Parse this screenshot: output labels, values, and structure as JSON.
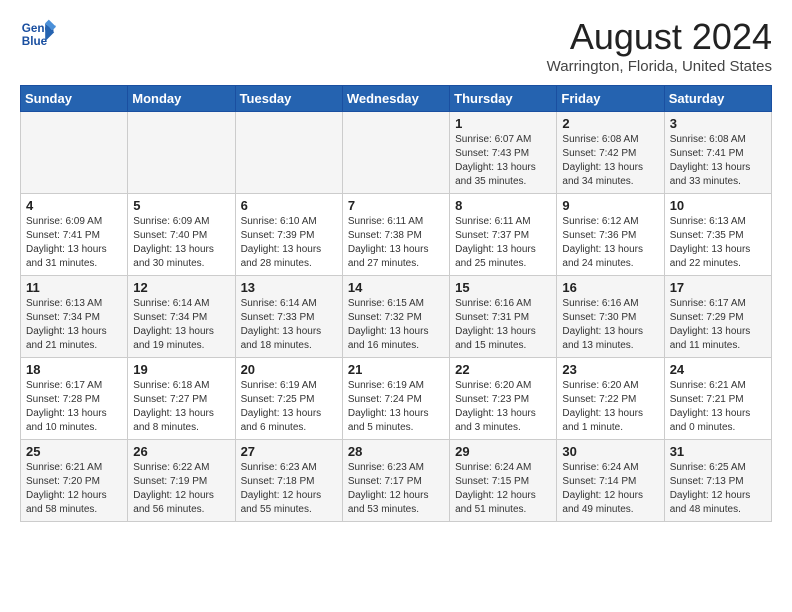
{
  "header": {
    "logo_line1": "General",
    "logo_line2": "Blue",
    "title": "August 2024",
    "subtitle": "Warrington, Florida, United States"
  },
  "weekdays": [
    "Sunday",
    "Monday",
    "Tuesday",
    "Wednesday",
    "Thursday",
    "Friday",
    "Saturday"
  ],
  "weeks": [
    [
      {
        "day": "",
        "info": ""
      },
      {
        "day": "",
        "info": ""
      },
      {
        "day": "",
        "info": ""
      },
      {
        "day": "",
        "info": ""
      },
      {
        "day": "1",
        "info": "Sunrise: 6:07 AM\nSunset: 7:43 PM\nDaylight: 13 hours\nand 35 minutes."
      },
      {
        "day": "2",
        "info": "Sunrise: 6:08 AM\nSunset: 7:42 PM\nDaylight: 13 hours\nand 34 minutes."
      },
      {
        "day": "3",
        "info": "Sunrise: 6:08 AM\nSunset: 7:41 PM\nDaylight: 13 hours\nand 33 minutes."
      }
    ],
    [
      {
        "day": "4",
        "info": "Sunrise: 6:09 AM\nSunset: 7:41 PM\nDaylight: 13 hours\nand 31 minutes."
      },
      {
        "day": "5",
        "info": "Sunrise: 6:09 AM\nSunset: 7:40 PM\nDaylight: 13 hours\nand 30 minutes."
      },
      {
        "day": "6",
        "info": "Sunrise: 6:10 AM\nSunset: 7:39 PM\nDaylight: 13 hours\nand 28 minutes."
      },
      {
        "day": "7",
        "info": "Sunrise: 6:11 AM\nSunset: 7:38 PM\nDaylight: 13 hours\nand 27 minutes."
      },
      {
        "day": "8",
        "info": "Sunrise: 6:11 AM\nSunset: 7:37 PM\nDaylight: 13 hours\nand 25 minutes."
      },
      {
        "day": "9",
        "info": "Sunrise: 6:12 AM\nSunset: 7:36 PM\nDaylight: 13 hours\nand 24 minutes."
      },
      {
        "day": "10",
        "info": "Sunrise: 6:13 AM\nSunset: 7:35 PM\nDaylight: 13 hours\nand 22 minutes."
      }
    ],
    [
      {
        "day": "11",
        "info": "Sunrise: 6:13 AM\nSunset: 7:34 PM\nDaylight: 13 hours\nand 21 minutes."
      },
      {
        "day": "12",
        "info": "Sunrise: 6:14 AM\nSunset: 7:34 PM\nDaylight: 13 hours\nand 19 minutes."
      },
      {
        "day": "13",
        "info": "Sunrise: 6:14 AM\nSunset: 7:33 PM\nDaylight: 13 hours\nand 18 minutes."
      },
      {
        "day": "14",
        "info": "Sunrise: 6:15 AM\nSunset: 7:32 PM\nDaylight: 13 hours\nand 16 minutes."
      },
      {
        "day": "15",
        "info": "Sunrise: 6:16 AM\nSunset: 7:31 PM\nDaylight: 13 hours\nand 15 minutes."
      },
      {
        "day": "16",
        "info": "Sunrise: 6:16 AM\nSunset: 7:30 PM\nDaylight: 13 hours\nand 13 minutes."
      },
      {
        "day": "17",
        "info": "Sunrise: 6:17 AM\nSunset: 7:29 PM\nDaylight: 13 hours\nand 11 minutes."
      }
    ],
    [
      {
        "day": "18",
        "info": "Sunrise: 6:17 AM\nSunset: 7:28 PM\nDaylight: 13 hours\nand 10 minutes."
      },
      {
        "day": "19",
        "info": "Sunrise: 6:18 AM\nSunset: 7:27 PM\nDaylight: 13 hours\nand 8 minutes."
      },
      {
        "day": "20",
        "info": "Sunrise: 6:19 AM\nSunset: 7:25 PM\nDaylight: 13 hours\nand 6 minutes."
      },
      {
        "day": "21",
        "info": "Sunrise: 6:19 AM\nSunset: 7:24 PM\nDaylight: 13 hours\nand 5 minutes."
      },
      {
        "day": "22",
        "info": "Sunrise: 6:20 AM\nSunset: 7:23 PM\nDaylight: 13 hours\nand 3 minutes."
      },
      {
        "day": "23",
        "info": "Sunrise: 6:20 AM\nSunset: 7:22 PM\nDaylight: 13 hours\nand 1 minute."
      },
      {
        "day": "24",
        "info": "Sunrise: 6:21 AM\nSunset: 7:21 PM\nDaylight: 13 hours\nand 0 minutes."
      }
    ],
    [
      {
        "day": "25",
        "info": "Sunrise: 6:21 AM\nSunset: 7:20 PM\nDaylight: 12 hours\nand 58 minutes."
      },
      {
        "day": "26",
        "info": "Sunrise: 6:22 AM\nSunset: 7:19 PM\nDaylight: 12 hours\nand 56 minutes."
      },
      {
        "day": "27",
        "info": "Sunrise: 6:23 AM\nSunset: 7:18 PM\nDaylight: 12 hours\nand 55 minutes."
      },
      {
        "day": "28",
        "info": "Sunrise: 6:23 AM\nSunset: 7:17 PM\nDaylight: 12 hours\nand 53 minutes."
      },
      {
        "day": "29",
        "info": "Sunrise: 6:24 AM\nSunset: 7:15 PM\nDaylight: 12 hours\nand 51 minutes."
      },
      {
        "day": "30",
        "info": "Sunrise: 6:24 AM\nSunset: 7:14 PM\nDaylight: 12 hours\nand 49 minutes."
      },
      {
        "day": "31",
        "info": "Sunrise: 6:25 AM\nSunset: 7:13 PM\nDaylight: 12 hours\nand 48 minutes."
      }
    ]
  ]
}
